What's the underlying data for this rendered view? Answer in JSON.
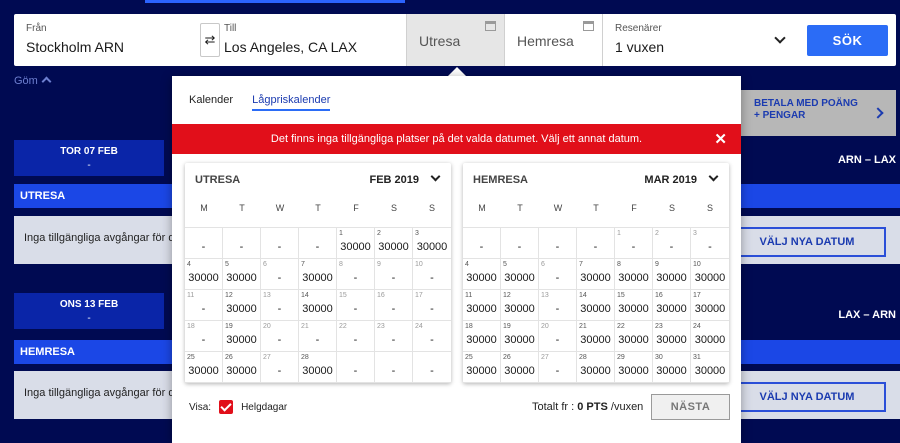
{
  "search": {
    "from_label": "Från",
    "from_value": "Stockholm ARN",
    "to_label": "Till",
    "to_value": "Los Angeles, CA LAX",
    "outbound_label": "Utresa",
    "return_label": "Hemresa",
    "travelers_label": "Resenärer",
    "travelers_value": "1 vuxen",
    "search_button": "SÖK"
  },
  "hide_link": "Göm",
  "background": {
    "pay_button": "BETALA MED POÄNG + PENGAR",
    "outbound": {
      "date_tab": "TOR 07 FEB",
      "date_sub": "-",
      "route": "ARN – LAX",
      "section": "UTRESA",
      "info": "Inga tillgängliga avgångar för de",
      "button": "VÄLJ NYA DATUM"
    },
    "return": {
      "date_tab": "ONS 13 FEB",
      "date_sub": "-",
      "route": "LAX – ARN",
      "section": "HEMRESA",
      "info": "Inga tillgängliga avgångar för de",
      "button": "VÄLJ NYA DATUM"
    }
  },
  "popup": {
    "tabs": [
      "Kalender",
      "Lågpriskalender"
    ],
    "active_tab": "Lågpriskalender",
    "alert": "Det finns inga tillgängliga platser på det valda datumet. Välj ett annat datum.",
    "weekdays": [
      "M",
      "T",
      "W",
      "T",
      "F",
      "S",
      "S"
    ],
    "calendars": [
      {
        "name": "UTRESA",
        "month": "FEB 2019",
        "cells": [
          {
            "d": "",
            "p": "-"
          },
          {
            "d": "",
            "p": "-"
          },
          {
            "d": "",
            "p": "-"
          },
          {
            "d": "",
            "p": "-"
          },
          {
            "d": "1",
            "p": "30000"
          },
          {
            "d": "2",
            "p": "30000"
          },
          {
            "d": "3",
            "p": "30000"
          },
          {
            "d": "4",
            "p": "30000"
          },
          {
            "d": "5",
            "p": "30000"
          },
          {
            "d": "6",
            "p": "-"
          },
          {
            "d": "7",
            "p": "30000"
          },
          {
            "d": "8",
            "p": "-"
          },
          {
            "d": "9",
            "p": "-"
          },
          {
            "d": "10",
            "p": "-"
          },
          {
            "d": "11",
            "p": "-"
          },
          {
            "d": "12",
            "p": "30000"
          },
          {
            "d": "13",
            "p": "-"
          },
          {
            "d": "14",
            "p": "30000"
          },
          {
            "d": "15",
            "p": "-"
          },
          {
            "d": "16",
            "p": "-"
          },
          {
            "d": "17",
            "p": "-"
          },
          {
            "d": "18",
            "p": "-"
          },
          {
            "d": "19",
            "p": "30000"
          },
          {
            "d": "20",
            "p": "-"
          },
          {
            "d": "21",
            "p": "-"
          },
          {
            "d": "22",
            "p": "-"
          },
          {
            "d": "23",
            "p": "-"
          },
          {
            "d": "24",
            "p": "-"
          },
          {
            "d": "25",
            "p": "30000"
          },
          {
            "d": "26",
            "p": "30000"
          },
          {
            "d": "27",
            "p": "-"
          },
          {
            "d": "28",
            "p": "30000"
          },
          {
            "d": "",
            "p": "-"
          },
          {
            "d": "",
            "p": "-"
          },
          {
            "d": "",
            "p": "-"
          }
        ]
      },
      {
        "name": "HEMRESA",
        "month": "MAR 2019",
        "cells": [
          {
            "d": "",
            "p": "-"
          },
          {
            "d": "",
            "p": "-"
          },
          {
            "d": "",
            "p": "-"
          },
          {
            "d": "",
            "p": "-"
          },
          {
            "d": "1",
            "p": "-"
          },
          {
            "d": "2",
            "p": "-"
          },
          {
            "d": "3",
            "p": "-"
          },
          {
            "d": "4",
            "p": "30000"
          },
          {
            "d": "5",
            "p": "30000"
          },
          {
            "d": "6",
            "p": "-"
          },
          {
            "d": "7",
            "p": "30000"
          },
          {
            "d": "8",
            "p": "30000"
          },
          {
            "d": "9",
            "p": "30000"
          },
          {
            "d": "10",
            "p": "30000"
          },
          {
            "d": "11",
            "p": "30000"
          },
          {
            "d": "12",
            "p": "30000"
          },
          {
            "d": "13",
            "p": "-"
          },
          {
            "d": "14",
            "p": "30000"
          },
          {
            "d": "15",
            "p": "30000"
          },
          {
            "d": "16",
            "p": "30000"
          },
          {
            "d": "17",
            "p": "30000"
          },
          {
            "d": "18",
            "p": "30000"
          },
          {
            "d": "19",
            "p": "30000"
          },
          {
            "d": "20",
            "p": "-"
          },
          {
            "d": "21",
            "p": "30000"
          },
          {
            "d": "22",
            "p": "30000"
          },
          {
            "d": "23",
            "p": "30000"
          },
          {
            "d": "24",
            "p": "30000"
          },
          {
            "d": "25",
            "p": "30000"
          },
          {
            "d": "26",
            "p": "30000"
          },
          {
            "d": "27",
            "p": "-"
          },
          {
            "d": "28",
            "p": "30000"
          },
          {
            "d": "29",
            "p": "30000"
          },
          {
            "d": "30",
            "p": "30000"
          },
          {
            "d": "31",
            "p": "30000"
          }
        ]
      }
    ],
    "show_label": "Visa:",
    "holidays_label": "Helgdagar",
    "total_prefix": "Totalt fr :",
    "total_value": "0 PTS",
    "total_suffix": "/vuxen",
    "next_button": "NÄSTA"
  },
  "colors": {
    "background": "#000a52",
    "accent": "#2b6cf6",
    "alert": "#e10f1a"
  }
}
